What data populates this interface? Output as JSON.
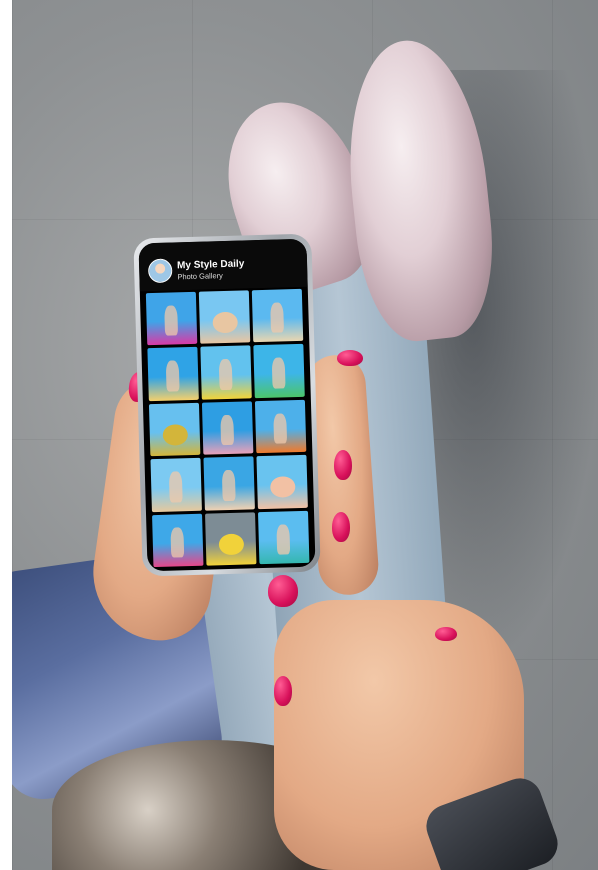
{
  "app": {
    "title": "My Style Daily",
    "subtitle": "Photo Gallery"
  },
  "gallery": {
    "tiles": [
      {
        "theme": "bougainvillea",
        "colors": [
          "#3fa4e8",
          "#d83aa6"
        ]
      },
      {
        "theme": "legs-on-sand",
        "colors": [
          "#79c7f2",
          "#e8c6a2"
        ]
      },
      {
        "theme": "beach-woman",
        "colors": [
          "#5bb9f0",
          "#e9d6b0"
        ]
      },
      {
        "theme": "cocktail-hand",
        "colors": [
          "#2fa3e6",
          "#f4d06c"
        ]
      },
      {
        "theme": "yellow-dress",
        "colors": [
          "#62c2ee",
          "#f2d33a"
        ]
      },
      {
        "theme": "green-drink",
        "colors": [
          "#3db5e8",
          "#4cc56a"
        ]
      },
      {
        "theme": "melon-on-sand",
        "colors": [
          "#67c0ef",
          "#d3b53a"
        ]
      },
      {
        "theme": "pink-bikini",
        "colors": [
          "#2e9ee3",
          "#e8a0b9"
        ]
      },
      {
        "theme": "orange-cocktail",
        "colors": [
          "#4db0ea",
          "#f07a2c"
        ]
      },
      {
        "theme": "sun-hat",
        "colors": [
          "#7ccaf2",
          "#e6c99d"
        ]
      },
      {
        "theme": "sea-sitting",
        "colors": [
          "#3aa6e4",
          "#f0d1b2"
        ]
      },
      {
        "theme": "feet-in-water",
        "colors": [
          "#69c3ef",
          "#f2c1a4"
        ]
      },
      {
        "theme": "pink-sarong",
        "colors": [
          "#3ea8e8",
          "#e5478a"
        ]
      },
      {
        "theme": "yellow-flip-flops",
        "colors": [
          "#7d8c95",
          "#f1d23a"
        ]
      },
      {
        "theme": "turquoise-dress",
        "colors": [
          "#5bbdf0",
          "#35b7b0"
        ]
      }
    ]
  }
}
